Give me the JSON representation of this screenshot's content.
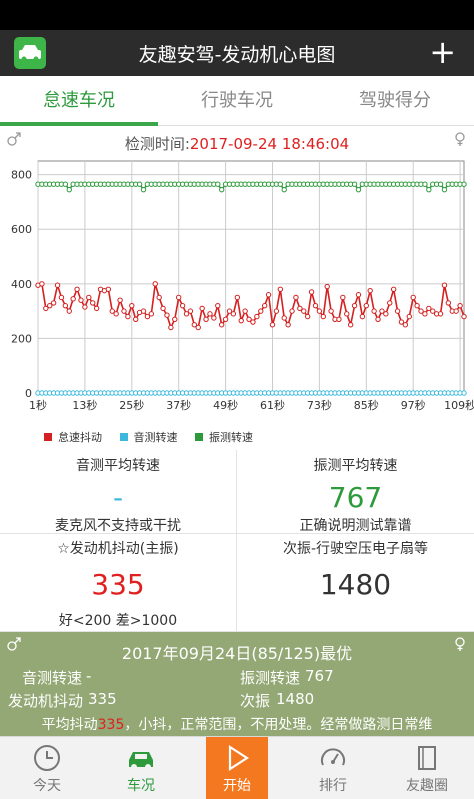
{
  "app": {
    "title": "友趣安驾-发动机心电图",
    "add_label": "+"
  },
  "tabs": [
    {
      "label": "怠速车况",
      "active": true
    },
    {
      "label": "行驶车况",
      "active": false
    },
    {
      "label": "驾驶得分",
      "active": false
    }
  ],
  "detect": {
    "label": "检测时间:",
    "value": "2017-09-24 18:46:04"
  },
  "chart_data": {
    "type": "line",
    "x_ticks": [
      "1秒",
      "13秒",
      "25秒",
      "37秒",
      "49秒",
      "61秒",
      "73秒",
      "85秒",
      "97秒",
      "109秒"
    ],
    "y_ticks": [
      "0",
      "200",
      "400",
      "600",
      "800"
    ],
    "ylim": [
      0,
      850
    ],
    "xlim": [
      1,
      110
    ],
    "series": [
      {
        "name": "怠速抖动",
        "color": "#d42020",
        "values": [
          395,
          400,
          310,
          320,
          330,
          395,
          350,
          320,
          300,
          345,
          380,
          340,
          315,
          350,
          330,
          310,
          380,
          375,
          380,
          300,
          290,
          340,
          300,
          280,
          320,
          270,
          295,
          300,
          280,
          290,
          400,
          350,
          310,
          285,
          240,
          270,
          350,
          320,
          290,
          300,
          250,
          240,
          310,
          270,
          290,
          275,
          320,
          250,
          270,
          300,
          290,
          350,
          265,
          300,
          270,
          260,
          280,
          300,
          320,
          360,
          250,
          300,
          380,
          275,
          250,
          300,
          350,
          310,
          300,
          280,
          370,
          320,
          300,
          280,
          390,
          300,
          270,
          270,
          350,
          290,
          250,
          320,
          360,
          280,
          320,
          375,
          300,
          270,
          300,
          290,
          330,
          380,
          300,
          260,
          250,
          280,
          350,
          320,
          300,
          290,
          310,
          300,
          290,
          290,
          395,
          330,
          300,
          300,
          320,
          280
        ]
      },
      {
        "name": "音测转速",
        "color": "#3cb8dc",
        "constant": 0
      },
      {
        "name": "振测转速",
        "color": "#2e9a3c",
        "base": 765,
        "dips": [
          [
            8,
            745
          ],
          [
            27,
            745
          ],
          [
            47,
            745
          ],
          [
            63,
            745
          ],
          [
            82,
            745
          ],
          [
            100,
            745
          ],
          [
            104,
            745
          ]
        ]
      }
    ]
  },
  "stats": {
    "sound_avg_title": "音测平均转速",
    "sound_avg_value": "-",
    "sound_avg_note": "麦克风不支持或干扰",
    "vib_avg_title": "振测平均转速",
    "vib_avg_value": "767",
    "vib_avg_note": "正确说明测试靠谱",
    "shake_title": "☆发动机抖动(主振)",
    "shake_value": "335",
    "shake_note": "好<200 差>1000",
    "secondary_title": "次振-行驶空压电子扇等",
    "secondary_value": "1480"
  },
  "summary": {
    "date": "2017年09月24日(85/125)最优",
    "sound_label": "音测转速",
    "sound_value": "-",
    "vib_label": "振测转速",
    "vib_value": "767",
    "shake_label": "发动机抖动",
    "shake_value": "335",
    "second_label": "次振",
    "second_value": "1480",
    "advice_pre": "平均抖动",
    "advice_value": "335",
    "advice_post": "，小抖，正常范围，不用处理。经常做路测日常维"
  },
  "nav": [
    {
      "label": "今天",
      "icon": "clock-icon"
    },
    {
      "label": "车况",
      "icon": "car-icon",
      "active": true
    },
    {
      "label": "开始",
      "icon": "play-icon",
      "start": true
    },
    {
      "label": "排行",
      "icon": "gauge-icon"
    },
    {
      "label": "友趣圈",
      "icon": "book-icon"
    }
  ],
  "colors": {
    "accent": "#3aa84a",
    "summary_bg": "#93a874",
    "start_bg": "#f4781f",
    "alert": "#e02020"
  }
}
